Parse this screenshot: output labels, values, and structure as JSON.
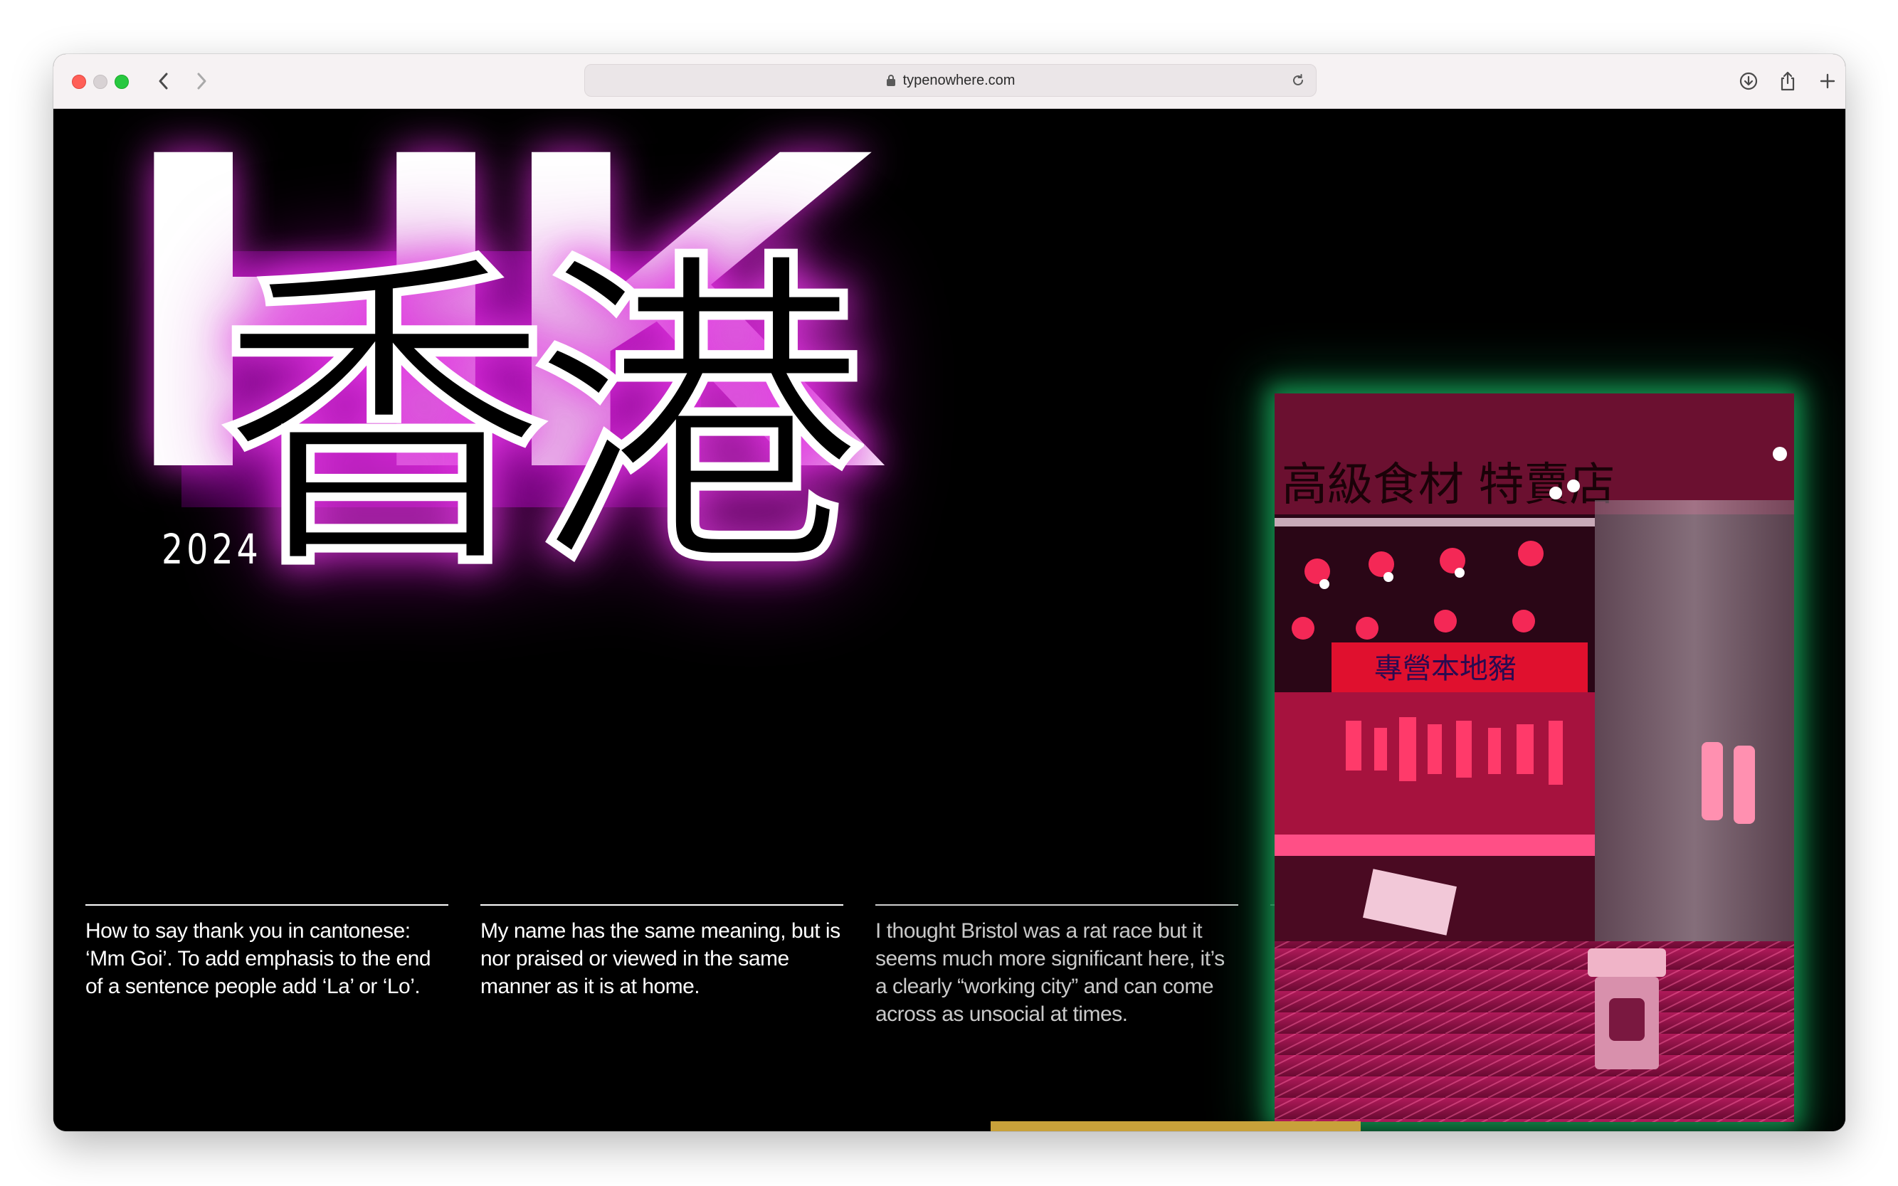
{
  "browser": {
    "url": "typenowhere.com"
  },
  "hero": {
    "latin_title": "HK",
    "cjk_title": "香港",
    "year": "2024"
  },
  "captions": [
    {
      "text": "How to say thank you in cantonese: ‘Mm Goi’. To add emphasis to the end of a sentence people add ‘La’ or ‘Lo’."
    },
    {
      "text": "My name has the same meaning, but is nor praised or viewed in the same manner as it is at home."
    },
    {
      "text": "I thought Bristol was a rat race but it seems much more significant here, it’s a clearly “working city” and can come across as unsocial at times."
    }
  ],
  "photo": {
    "banner_text": "高級食材 特賣店",
    "sign_text": "專營本地豬"
  },
  "colors": {
    "accent_purple": "#8e10a2",
    "glow_green": "#1edc78",
    "scrollbar": "#c8a13a"
  }
}
